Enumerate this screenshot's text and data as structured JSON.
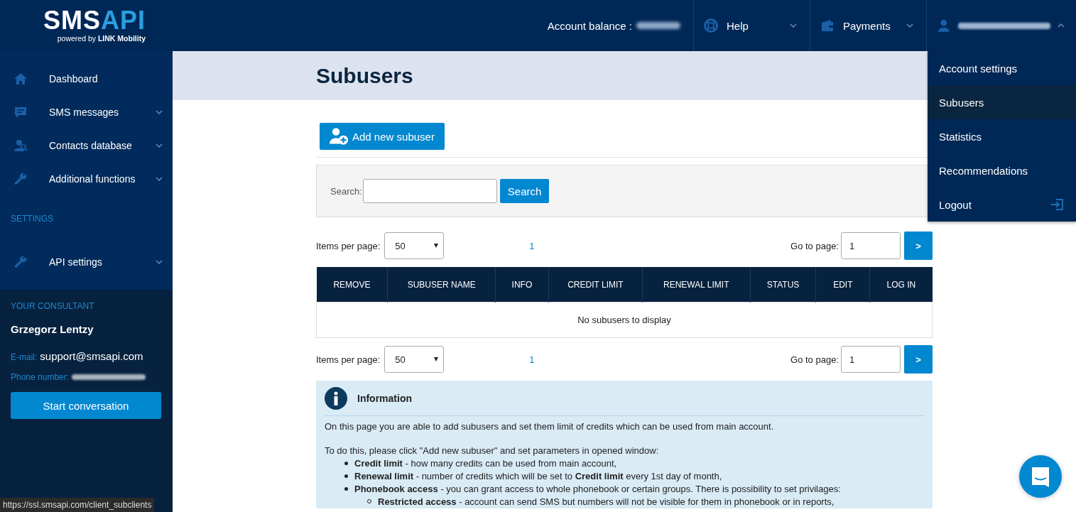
{
  "logo": {
    "wordmark_left": "SMS",
    "wordmark_right": "API",
    "tagline": "powered by **LINK Mobility**"
  },
  "header": {
    "balance_label": "Account balance :",
    "menus": [
      {
        "label": "Help",
        "kind": "lifebuoy",
        "expanded": false
      },
      {
        "label": "Payments",
        "kind": "wallet",
        "expanded": false
      }
    ],
    "user_menu": {
      "expanded": true,
      "items": [
        {
          "label": "Account settings",
          "selected": false,
          "kind": "link"
        },
        {
          "label": "Subusers",
          "selected": true,
          "kind": "link"
        },
        {
          "label": "Statistics",
          "selected": false,
          "kind": "link"
        },
        {
          "label": "Recommendations",
          "selected": false,
          "kind": "link"
        },
        {
          "label": "Logout",
          "selected": false,
          "kind": "logout"
        }
      ]
    }
  },
  "sidebar": {
    "items": [
      {
        "label": "Dashboard",
        "kind": "home",
        "has_submenu": false
      },
      {
        "label": "SMS messages",
        "kind": "chat",
        "has_submenu": true
      },
      {
        "label": "Contacts database",
        "kind": "contacts",
        "has_submenu": true
      },
      {
        "label": "Additional functions",
        "kind": "wrench",
        "has_submenu": true
      }
    ],
    "settings_heading": "SETTINGS",
    "settings_items": [
      {
        "label": "API settings",
        "kind": "wrench",
        "has_submenu": true
      }
    ],
    "consultant": {
      "heading": "YOUR CONSULTANT",
      "name": "Grzegorz Lentzy",
      "email_label": "E-mail:",
      "email": "support@smsapi.com",
      "phone_label": "Phone number:",
      "button": "Start conversation"
    }
  },
  "page": {
    "title": "Subusers",
    "add_button": "Add new subuser",
    "search": {
      "label": "Search:",
      "button": "Search"
    },
    "pagers": [
      {
        "items_label": "Items per page:",
        "per_page": "50",
        "page": "1",
        "goto_label": "Go to page:",
        "goto_value": "1",
        "next": ">"
      },
      {
        "items_label": "Items per page:",
        "per_page": "50",
        "page": "1",
        "goto_label": "Go to page:",
        "goto_value": "1",
        "next": ">"
      }
    ],
    "table": {
      "columns": [
        "REMOVE",
        "SUBUSER NAME",
        "INFO",
        "CREDIT LIMIT",
        "RENEWAL LIMIT",
        "STATUS",
        "EDIT",
        "LOG IN"
      ],
      "empty_message": "No subusers to display"
    },
    "info": {
      "title": "Information",
      "paragraphs": [
        "On this page you are able to add subusers and set them limit of credits which can be used from main account.",
        "To do this, please click \"Add new subuser\" and set parameters in opened window:"
      ],
      "list": [
        {
          "text": "**Credit limit** - how many credits can be used from main account,"
        },
        {
          "text": "**Renewal limit** - number of credits which will be set to **Credit limit** every 1st day of month,"
        },
        {
          "text": "**Phonebook access** - you can grant access to whole phonebook or certain groups. There is possibility to set privilages:",
          "children": [
            {
              "text": "**Restricted access** - account can send SMS but numbers will not be visible for them in phonebook or in reports,"
            }
          ]
        }
      ]
    }
  },
  "status_bar": {
    "url": "https://ssl.smsapi.com/client_subclients"
  }
}
